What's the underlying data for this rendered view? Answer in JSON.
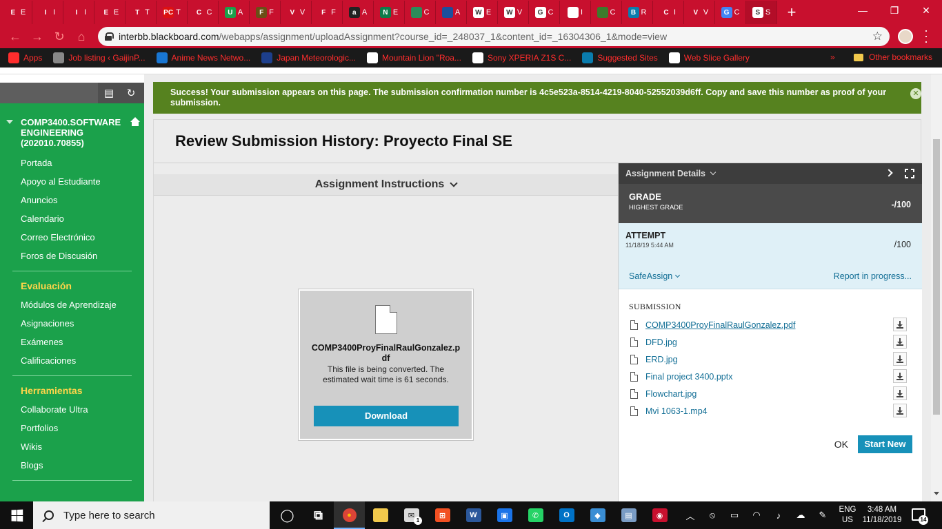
{
  "browser": {
    "tabs": [
      {
        "icon": "tab-favicon",
        "color": "#c8102e",
        "letter": "E",
        "label": "E"
      },
      {
        "icon": "tab-favicon",
        "color": "#c8102e",
        "letter": "I",
        "label": "I"
      },
      {
        "icon": "tab-favicon",
        "color": "#c8102e",
        "letter": "I",
        "label": "I"
      },
      {
        "icon": "tab-favicon",
        "color": "#c8102e",
        "letter": "E",
        "label": "E"
      },
      {
        "icon": "tab-favicon",
        "color": "#c8102e",
        "letter": "T",
        "label": "T"
      },
      {
        "icon": "tab-favicon",
        "color": "#d11",
        "letter": "PC",
        "label": "T"
      },
      {
        "icon": "tab-favicon",
        "color": "#c8102e",
        "letter": "C",
        "label": "C"
      },
      {
        "icon": "tab-favicon",
        "color": "#1ba14b",
        "letter": "U",
        "label": "A"
      },
      {
        "icon": "tab-favicon",
        "color": "#6b4e16",
        "letter": "F",
        "label": "F"
      },
      {
        "icon": "tab-favicon",
        "color": "#c8102e",
        "letter": "V",
        "label": "V"
      },
      {
        "icon": "tab-favicon",
        "color": "#c8102e",
        "letter": "F",
        "label": "F"
      },
      {
        "icon": "tab-favicon",
        "color": "#222",
        "letter": "a",
        "label": "A"
      },
      {
        "icon": "tab-favicon",
        "color": "#0e7c4a",
        "letter": "N",
        "label": "E"
      },
      {
        "icon": "tab-favicon",
        "color": "#2b8c5a",
        "letter": "",
        "label": "C"
      },
      {
        "icon": "tab-favicon",
        "color": "#1d4f9c",
        "letter": "",
        "label": "A"
      },
      {
        "icon": "tab-favicon",
        "color": "#fff",
        "letter": "W",
        "label": "E"
      },
      {
        "icon": "tab-favicon",
        "color": "#fff",
        "letter": "W",
        "label": "V"
      },
      {
        "icon": "tab-favicon",
        "color": "#fff",
        "letter": "G",
        "label": "C"
      },
      {
        "icon": "tab-favicon",
        "color": "#fff",
        "letter": "",
        "label": "I"
      },
      {
        "icon": "tab-favicon",
        "color": "#3d7a2c",
        "letter": "",
        "label": "C"
      },
      {
        "icon": "tab-favicon",
        "color": "#0a7cad",
        "letter": "B",
        "label": "R"
      },
      {
        "icon": "tab-favicon",
        "color": "#c8102e",
        "letter": "C",
        "label": "I"
      },
      {
        "icon": "tab-favicon",
        "color": "#c8102e",
        "letter": "V",
        "label": "V"
      },
      {
        "icon": "tab-favicon",
        "color": "#4285f4",
        "letter": "G",
        "label": "C"
      },
      {
        "icon": "tab-favicon",
        "color": "#fff",
        "letter": "S",
        "label": "S"
      }
    ],
    "new_tab": "+",
    "url_host": "interbb.blackboard.com",
    "url_path": "/webapps/assignment/uploadAssignment?course_id=_248037_1&content_id=_16304306_1&mode=view",
    "bookmarks": [
      {
        "label": "Apps",
        "color": "#ff2d2d"
      },
      {
        "label": "Job listing ‹ GaijinP...",
        "color": "#888"
      },
      {
        "label": "Anime News Netwo...",
        "color": "#1976d2"
      },
      {
        "label": "Japan Meteorologic...",
        "color": "#1d3f8c"
      },
      {
        "label": "Mountain Lion \"Roa...",
        "color": "#fff"
      },
      {
        "label": "Sony XPERIA Z1S C...",
        "color": "#fff"
      },
      {
        "label": "Suggested Sites",
        "color": "#0a7cad"
      },
      {
        "label": "Web Slice Gallery",
        "color": "#fff"
      }
    ],
    "bookmarks_more": "»",
    "other_bookmarks": "Other bookmarks"
  },
  "sidebar": {
    "course_title": "COMP3400.SOFTWARE ENGINEERING (202010.70855)",
    "main_items": [
      "Portada",
      "Apoyo al Estudiante",
      "Anuncios",
      "Calendario",
      "Correo Electrónico",
      "Foros de Discusión"
    ],
    "section1_heading": "Evaluación",
    "section1_items": [
      "Módulos de Aprendizaje",
      "Asignaciones",
      "Exámenes",
      "Calificaciones"
    ],
    "section2_heading": "Herramientas",
    "section2_items": [
      "Collaborate Ultra",
      "Portfolios",
      "Wikis",
      "Blogs"
    ]
  },
  "success_message": "Success! Your submission appears on this page. The submission confirmation number is 4c5e523a-8514-4219-8040-52552039d6ff. Copy and save this number as proof of your submission.",
  "review": {
    "title": "Review Submission History: Proyecto Final SE",
    "instructions_label": "Assignment Instructions",
    "viewer": {
      "file_name": "COMP3400ProyFinalRaulGonzalez.pdf",
      "message": "This file is being converted. The estimated wait time is 61 seconds.",
      "download_label": "Download"
    }
  },
  "details": {
    "header": "Assignment Details",
    "grade_label": "GRADE",
    "grade_sub": "HIGHEST GRADE",
    "grade_value": "-/100",
    "attempt_label": "ATTEMPT",
    "attempt_date": "11/18/19 5:44 AM",
    "attempt_value": "/100",
    "safeassign_label": "SafeAssign",
    "report_label": "Report in progress...",
    "submission_label": "SUBMISSION",
    "files": [
      "COMP3400ProyFinalRaulGonzalez.pdf",
      "DFD.jpg",
      "ERD.jpg",
      "Final project 3400.pptx",
      "Flowchart.jpg",
      "Mvi 1063-1.mp4"
    ],
    "ok_label": "OK",
    "start_new_label": "Start New"
  },
  "taskbar": {
    "search_placeholder": "Type here to search",
    "apps": [
      {
        "name": "task-view-icon",
        "color": "#101010",
        "symbol": "◯"
      },
      {
        "name": "timeline-icon",
        "color": "#101010",
        "symbol": "⧉"
      },
      {
        "name": "chrome-icon",
        "color": "#db4437",
        "symbol": "●"
      },
      {
        "name": "file-explorer-icon",
        "color": "#f2c94c",
        "symbol": ""
      },
      {
        "name": "mail-icon",
        "color": "#dcdcdc",
        "symbol": "✉"
      },
      {
        "name": "store-icon",
        "color": "#f25022",
        "symbol": "⊞"
      },
      {
        "name": "word-icon",
        "color": "#2b579a",
        "symbol": "W"
      },
      {
        "name": "photos-app-icon",
        "color": "#1a73e8",
        "symbol": "▣"
      },
      {
        "name": "whatsapp-icon",
        "color": "#25d366",
        "symbol": "✆"
      },
      {
        "name": "outlook-icon",
        "color": "#0072c6",
        "symbol": "O"
      },
      {
        "name": "box-app-icon",
        "color": "#3a8ed4",
        "symbol": "◆"
      },
      {
        "name": "scanner-app-icon",
        "color": "#7a9cc4",
        "symbol": "▤"
      },
      {
        "name": "circle-app-icon",
        "color": "#c8102e",
        "symbol": "◉"
      }
    ],
    "mail_badge": "1",
    "language_line1": "ENG",
    "language_line2": "US",
    "time": "3:48 AM",
    "date": "11/18/2019",
    "notification_count": "14"
  }
}
